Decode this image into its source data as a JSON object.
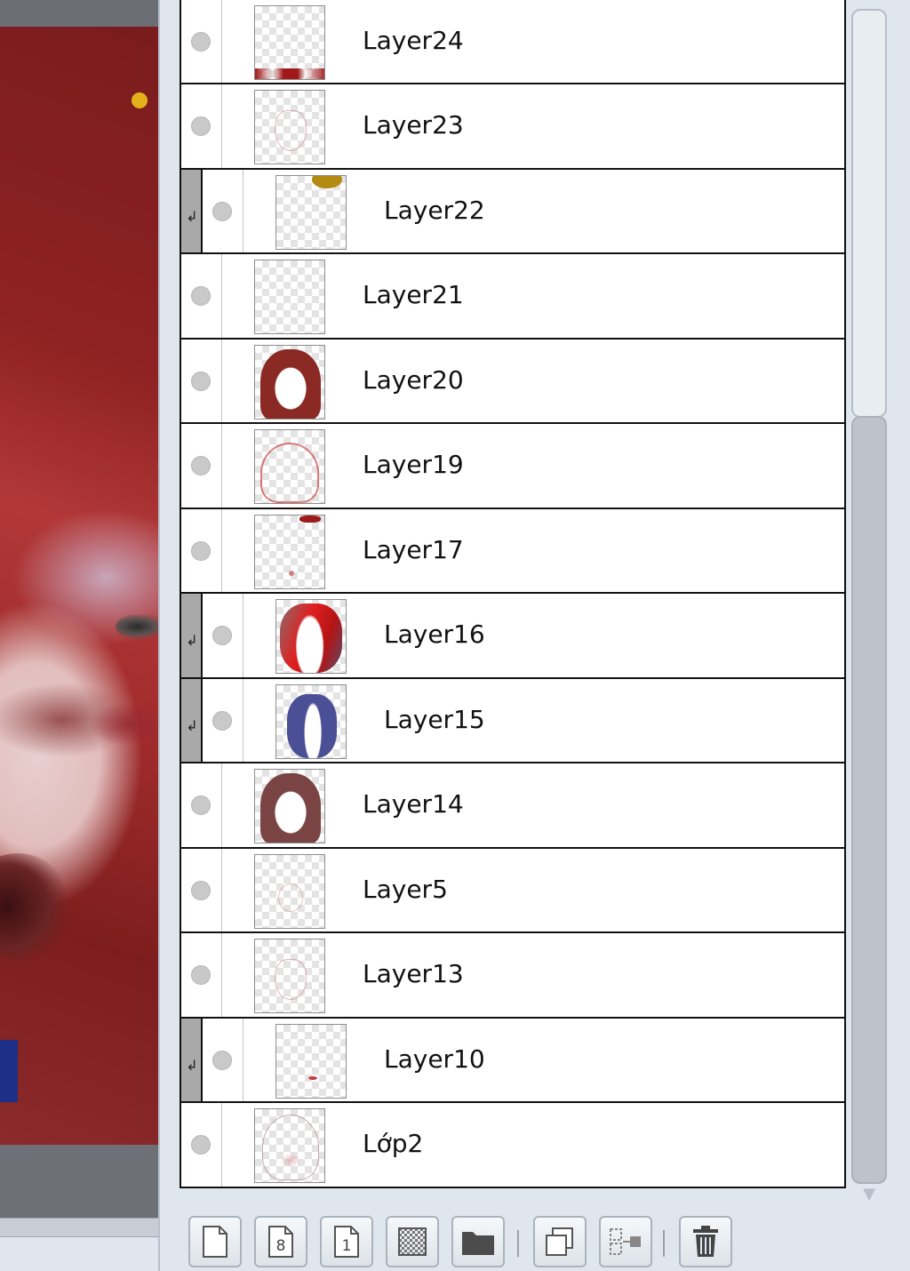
{
  "layers_panel": {
    "layers": [
      {
        "name": "",
        "clipped": false,
        "thumb": "partial-top"
      },
      {
        "name": "Layer24",
        "clipped": false,
        "thumb": "red-bottom"
      },
      {
        "name": "Layer23",
        "clipped": false,
        "thumb": "faint-sketch"
      },
      {
        "name": "Layer22",
        "clipped": true,
        "thumb": "yellow-top"
      },
      {
        "name": "Layer21",
        "clipped": false,
        "thumb": "empty"
      },
      {
        "name": "Layer20",
        "clipped": false,
        "thumb": "hair-dark-red"
      },
      {
        "name": "Layer19",
        "clipped": false,
        "thumb": "red-lineart"
      },
      {
        "name": "Layer17",
        "clipped": false,
        "thumb": "small-red-marks"
      },
      {
        "name": "Layer16",
        "clipped": true,
        "thumb": "red-strokes"
      },
      {
        "name": "Layer15",
        "clipped": true,
        "thumb": "blue-strokes"
      },
      {
        "name": "Layer14",
        "clipped": false,
        "thumb": "hair-brown"
      },
      {
        "name": "Layer5",
        "clipped": false,
        "thumb": "faint-face"
      },
      {
        "name": "Layer13",
        "clipped": false,
        "thumb": "faint-sketch"
      },
      {
        "name": "Layer10",
        "clipped": true,
        "thumb": "tiny-red-dot"
      },
      {
        "name": "Lớp2",
        "clipped": false,
        "thumb": "face-lineart"
      }
    ],
    "toolbar": [
      {
        "icon": "new-layer-icon"
      },
      {
        "icon": "new-8bit-layer-icon",
        "glyph": "8"
      },
      {
        "icon": "new-1bit-layer-icon",
        "glyph": "1"
      },
      {
        "icon": "new-halftone-layer-icon"
      },
      {
        "icon": "new-folder-icon"
      },
      {
        "icon": "duplicate-layer-icon"
      },
      {
        "icon": "merge-layer-icon"
      },
      {
        "icon": "delete-layer-icon"
      }
    ]
  },
  "colors": {
    "canvas_red": "#8f2222",
    "panel_bg": "#dfe6ee",
    "clip_strip": "#a9a9a9",
    "row_border": "#111111"
  }
}
